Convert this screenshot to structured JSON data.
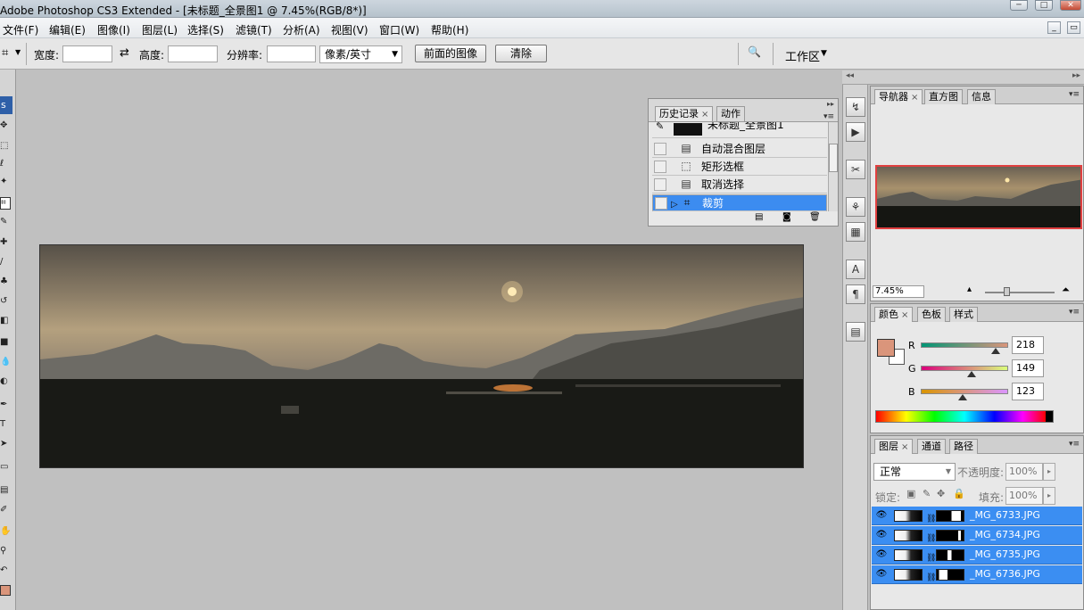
{
  "window": {
    "title": "Adobe Photoshop CS3 Extended - [未标题_全景图1 @ 7.45%(RGB/8*)]"
  },
  "menu": [
    "文件(F)",
    "编辑(E)",
    "图像(I)",
    "图层(L)",
    "选择(S)",
    "滤镜(T)",
    "分析(A)",
    "视图(V)",
    "窗口(W)",
    "帮助(H)"
  ],
  "options": {
    "width_label": "宽度:",
    "height_label": "高度:",
    "resolution_label": "分辨率:",
    "unit_value": "像素/英寸",
    "front_image_label": "前面的图像",
    "clear_label": "清除",
    "workspace_label": "工作区"
  },
  "toolbox": {
    "head": "s"
  },
  "history": {
    "tabs": [
      "历史记录",
      "动作"
    ],
    "snapshot_name": "未标题_全景图1",
    "items": [
      "自动混合图层",
      "矩形选框",
      "取消选择",
      "裁剪"
    ],
    "selected_index": 3
  },
  "navigator": {
    "tabs": [
      "导航器",
      "直方图",
      "信息"
    ],
    "zoom": "7.45%"
  },
  "color": {
    "tabs": [
      "颜色",
      "色板",
      "样式"
    ],
    "foreground": "#da957b",
    "r_label": "R",
    "g_label": "G",
    "b_label": "B",
    "r": 218,
    "g": 149,
    "b": 123
  },
  "layers": {
    "tabs": [
      "图层",
      "通道",
      "路径"
    ],
    "blend_mode": "正常",
    "opacity_label": "不透明度:",
    "opacity": "100%",
    "lock_label": "锁定:",
    "fill_label": "填充:",
    "fill": "100%",
    "items": [
      "_MG_6733.JPG",
      "_MG_6734.JPG",
      "_MG_6735.JPG",
      "_MG_6736.JPG"
    ]
  }
}
